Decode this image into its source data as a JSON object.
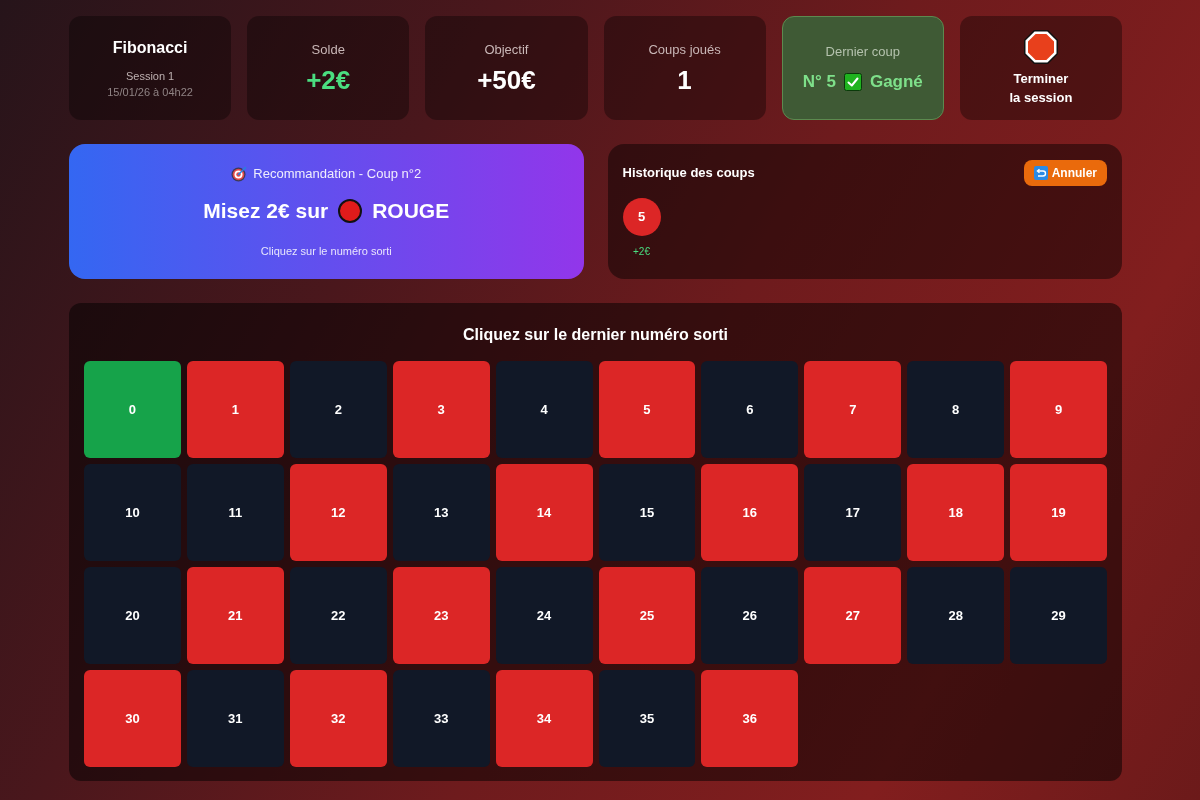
{
  "stats": {
    "session": {
      "strategy": "Fibonacci",
      "name": "Session 1",
      "date": "15/01/26 à 04h22"
    },
    "balance": {
      "label": "Solde",
      "value": "+2€"
    },
    "target": {
      "label": "Objectif",
      "value": "+50€"
    },
    "moves_played": {
      "label": "Coups joués",
      "value": "1"
    },
    "last_move": {
      "label": "Dernier coup",
      "number": "N° 5",
      "won": true,
      "result": "Gagné"
    },
    "end_button": {
      "lines": [
        "Terminer",
        "la session"
      ]
    }
  },
  "recommendation": {
    "heading": "Recommandation - Coup n°2",
    "bet": "Misez 2€ sur",
    "bet_label": "ROUGE",
    "hint": "Cliquez sur le numéro sorti"
  },
  "history": {
    "title": "Historique des coups",
    "undo_button": "Annuler",
    "items": [
      {
        "number": "5",
        "color": "#dc2626",
        "gain": "+2€"
      }
    ]
  },
  "grid": {
    "title": "Cliquez sur le dernier numéro sorti",
    "numbers": [
      {
        "label": "0",
        "color": "#16a34a"
      },
      {
        "label": "1",
        "color": "#dc2626"
      },
      {
        "label": "2",
        "color": "#111827"
      },
      {
        "label": "3",
        "color": "#dc2626"
      },
      {
        "label": "4",
        "color": "#111827"
      },
      {
        "label": "5",
        "color": "#dc2626"
      },
      {
        "label": "6",
        "color": "#111827"
      },
      {
        "label": "7",
        "color": "#dc2626"
      },
      {
        "label": "8",
        "color": "#111827"
      },
      {
        "label": "9",
        "color": "#dc2626"
      },
      {
        "label": "10",
        "color": "#111827"
      },
      {
        "label": "11",
        "color": "#111827"
      },
      {
        "label": "12",
        "color": "#dc2626"
      },
      {
        "label": "13",
        "color": "#111827"
      },
      {
        "label": "14",
        "color": "#dc2626"
      },
      {
        "label": "15",
        "color": "#111827"
      },
      {
        "label": "16",
        "color": "#dc2626"
      },
      {
        "label": "17",
        "color": "#111827"
      },
      {
        "label": "18",
        "color": "#dc2626"
      },
      {
        "label": "19",
        "color": "#dc2626"
      },
      {
        "label": "20",
        "color": "#111827"
      },
      {
        "label": "21",
        "color": "#dc2626"
      },
      {
        "label": "22",
        "color": "#111827"
      },
      {
        "label": "23",
        "color": "#dc2626"
      },
      {
        "label": "24",
        "color": "#111827"
      },
      {
        "label": "25",
        "color": "#dc2626"
      },
      {
        "label": "26",
        "color": "#111827"
      },
      {
        "label": "27",
        "color": "#dc2626"
      },
      {
        "label": "28",
        "color": "#111827"
      },
      {
        "label": "29",
        "color": "#111827"
      },
      {
        "label": "30",
        "color": "#dc2626"
      },
      {
        "label": "31",
        "color": "#111827"
      },
      {
        "label": "32",
        "color": "#dc2626"
      },
      {
        "label": "33",
        "color": "#111827"
      },
      {
        "label": "34",
        "color": "#dc2626"
      },
      {
        "label": "35",
        "color": "#111827"
      },
      {
        "label": "36",
        "color": "#dc2626"
      }
    ]
  }
}
